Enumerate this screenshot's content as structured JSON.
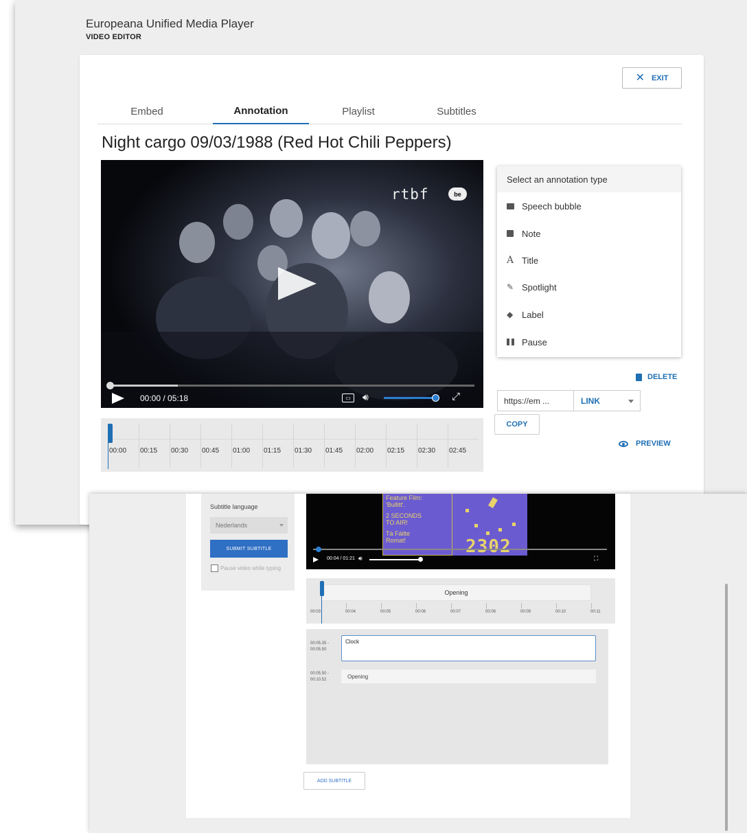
{
  "app": {
    "title": "Europeana Unified Media Player",
    "subtitle": "VIDEO EDITOR"
  },
  "header": {
    "exit_label": "EXIT"
  },
  "tabs": [
    {
      "label": "Embed"
    },
    {
      "label": "Annotation",
      "active": true
    },
    {
      "label": "Playlist"
    },
    {
      "label": "Subtitles"
    }
  ],
  "video": {
    "title": "Night cargo 09/03/1988 (Red Hot Chili Peppers)",
    "time_display": "00:00 / 05:18",
    "logo_text": "rtbf",
    "logo_badge": "be",
    "progress_fraction": 0.0,
    "volume_fraction": 0.95
  },
  "timeline": {
    "labels": [
      "00:00",
      "00:15",
      "00:30",
      "00:45",
      "01:00",
      "01:15",
      "01:30",
      "01:45",
      "02:00",
      "02:15",
      "02:30",
      "02:45"
    ]
  },
  "annotation_menu": {
    "header": "Select an annotation type",
    "items": [
      {
        "label": "Speech bubble",
        "icon": "speech-bubble-icon"
      },
      {
        "label": "Note",
        "icon": "note-icon"
      },
      {
        "label": "Title",
        "icon": "title-icon"
      },
      {
        "label": "Spotlight",
        "icon": "spotlight-icon"
      },
      {
        "label": "Label",
        "icon": "label-tag-icon"
      },
      {
        "label": "Pause",
        "icon": "pause-icon"
      }
    ]
  },
  "actions": {
    "delete_label": "DELETE",
    "url_value": "https://em ...",
    "link_type": "LINK",
    "copy_label": "COPY",
    "preview_label": "PREVIEW"
  },
  "subtitle_editor": {
    "language_label": "Subtitle language",
    "language_value": "Nederlands",
    "submit_label": "SUBMIT SUBTITLE",
    "pause_label": "Pause video while typing",
    "video_time": "00:04 / 01:21",
    "poster_lines": [
      "Feature Film:",
      "'Bullitt'.",
      "2 SECONDS",
      "TO AIR!",
      "Tá Fáilte",
      "Romat!"
    ],
    "clock_digits": "2302",
    "timeline_block_label": "Opening",
    "timeline_labels": [
      "00:03",
      "00:04",
      "00:05",
      "00:06",
      "00:07",
      "00:08",
      "00:09",
      "00:10",
      "00:11"
    ],
    "subtitles": [
      {
        "time_start": "00:05.35 -",
        "time_end": "00:05.50",
        "text": "Clock"
      },
      {
        "time_start": "00:05.50 -",
        "time_end": "00:10.52",
        "text": "Opening"
      }
    ],
    "add_label": "ADD SUBTITLE"
  },
  "colors": {
    "accent": "#1f6fb3",
    "poster": "#6b5bd0",
    "poster_text": "#e8d36a"
  }
}
